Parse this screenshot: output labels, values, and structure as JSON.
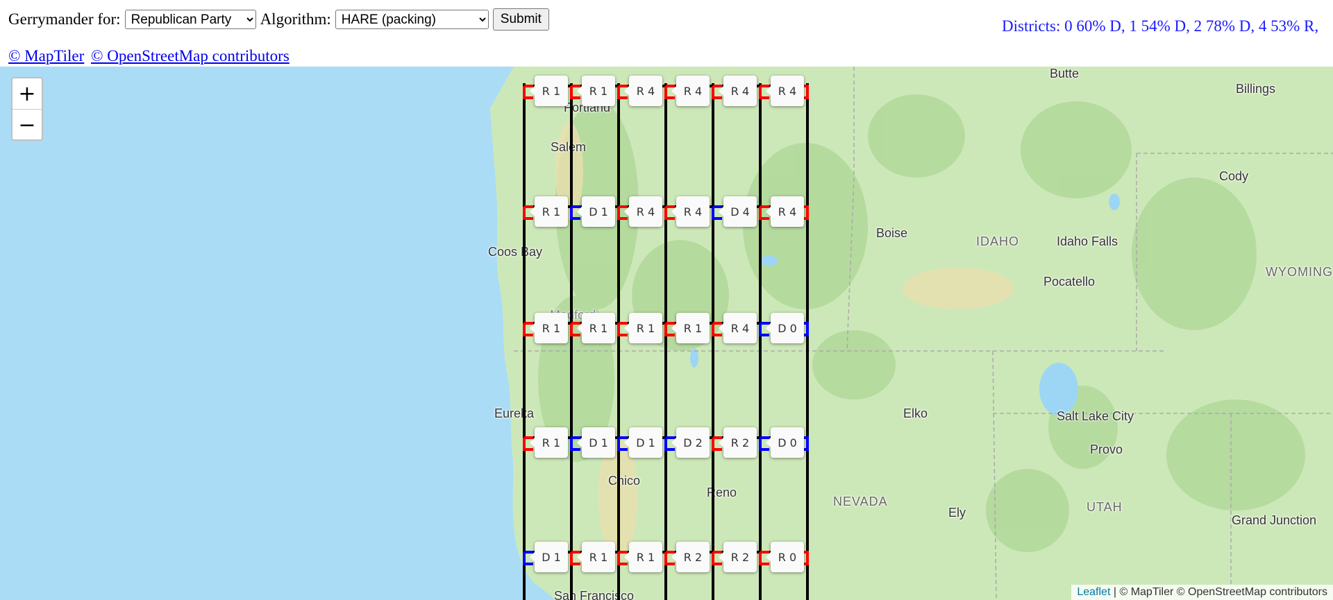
{
  "controls": {
    "gerrymander_label": "Gerrymander for:",
    "party_options": [
      "Republican Party"
    ],
    "party_selected": "Republican Party",
    "algorithm_label": "Algorithm:",
    "algorithm_options": [
      "HARE (packing)"
    ],
    "algorithm_selected": "HARE (packing)",
    "submit_label": "Submit"
  },
  "districts_summary": "Districts: 0 60% D, 1 54% D, 2 78% D, 4 53% R,",
  "credits": [
    "© MapTiler",
    "© OpenStreetMap contributors"
  ],
  "map": {
    "zoom_in": "+",
    "zoom_out": "−",
    "attribution": {
      "leaflet": "Leaflet",
      "separator": " | ",
      "rest": "© MapTiler © OpenStreetMap contributors"
    },
    "colors": {
      "republican": "#ff0000",
      "democrat": "#0000ff",
      "grid": "#000000",
      "ocean": "#aadcf5",
      "land": "#cde8b8"
    },
    "places": [
      "Butte",
      "Billings",
      "Portland",
      "Salem",
      "Cody",
      "Boise",
      "IDAHO",
      "Idaho Falls",
      "Coos Bay",
      "Pocatello",
      "WYOMING",
      "Medford",
      "Eureka",
      "Elko",
      "Salt Lake City",
      "Provo",
      "Chico",
      "Reno",
      "NEVADA",
      "Ely",
      "UTAH",
      "Grand Junction",
      "San Francisco"
    ],
    "grid": [
      [
        "R 1",
        "R 1",
        "R 4",
        "R 4",
        "R 4",
        "R 4"
      ],
      [
        "R 1",
        "D 1",
        "R 4",
        "R 4",
        "D 4",
        "R 4"
      ],
      [
        "R 1",
        "R 1",
        "R 1",
        "R 1",
        "R 4",
        "D 0"
      ],
      [
        "R 1",
        "D 1",
        "D 1",
        "D 2",
        "R 2",
        "D 0"
      ],
      [
        "D 1",
        "R 1",
        "R 1",
        "R 2",
        "R 2",
        "R 0"
      ]
    ]
  }
}
